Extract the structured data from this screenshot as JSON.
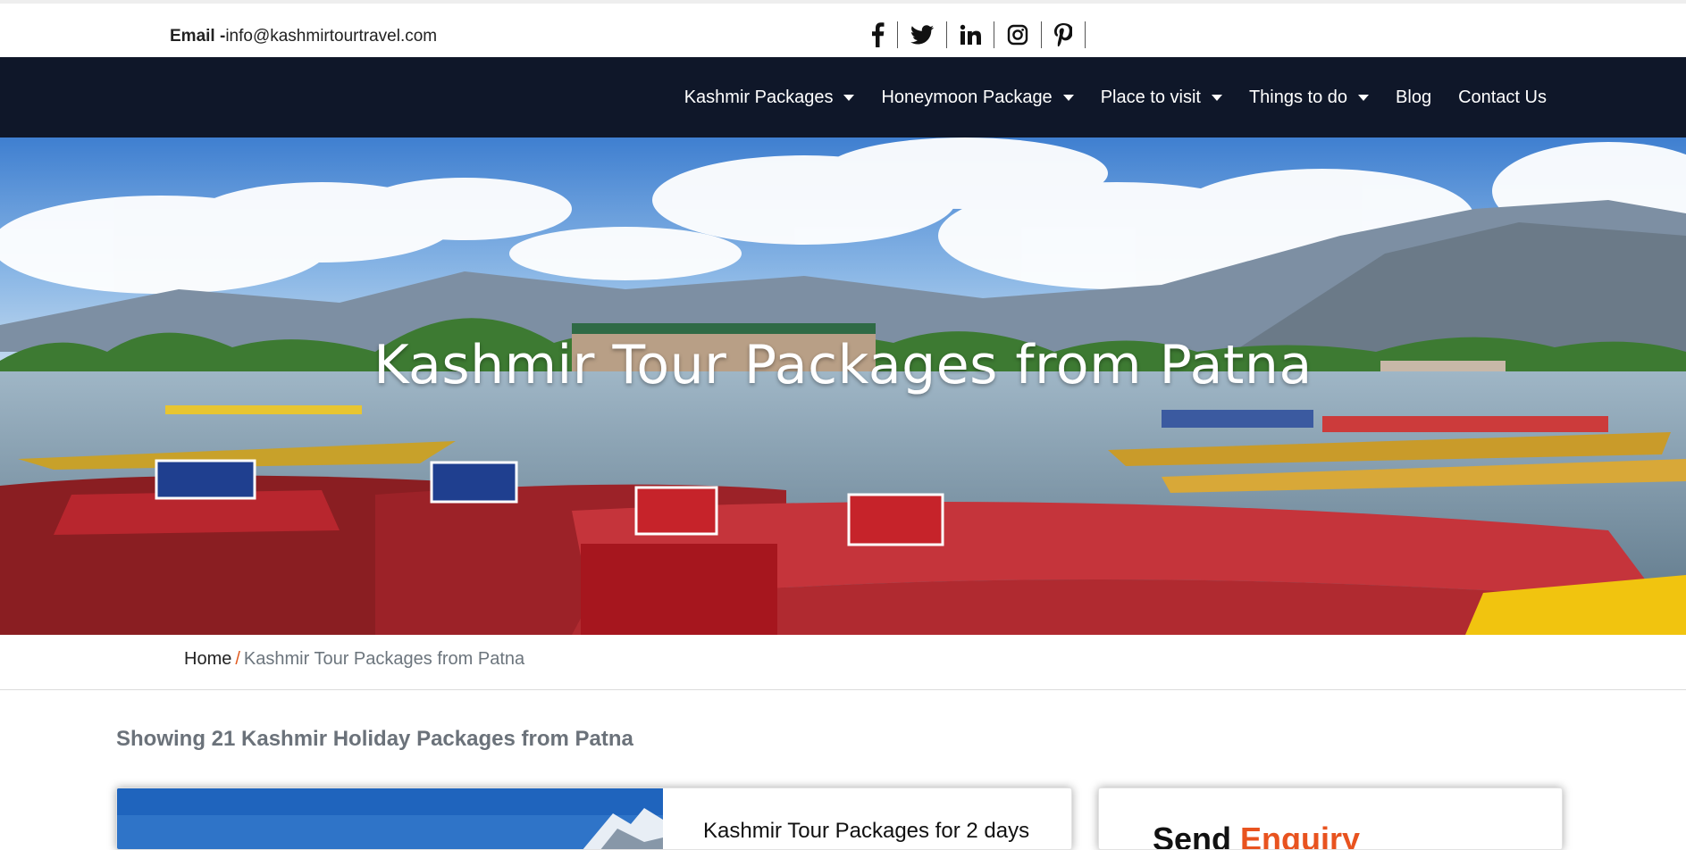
{
  "topbar": {
    "email_label": "Email -",
    "email_value": "info@kashmirtourtravel.com",
    "social": [
      "facebook-icon",
      "twitter-icon",
      "linkedin-icon",
      "instagram-icon",
      "pinterest-icon"
    ]
  },
  "nav": {
    "items": [
      {
        "label": "Kashmir Packages",
        "dropdown": true
      },
      {
        "label": "Honeymoon Package",
        "dropdown": true
      },
      {
        "label": "Place to visit",
        "dropdown": true
      },
      {
        "label": "Things to do",
        "dropdown": true
      },
      {
        "label": "Blog",
        "dropdown": false
      },
      {
        "label": "Contact Us",
        "dropdown": false
      }
    ]
  },
  "hero": {
    "title": "Kashmir Tour Packages from Patna"
  },
  "breadcrumb": {
    "home": "Home",
    "separator": "/",
    "current": "Kashmir Tour Packages from Patna"
  },
  "listing": {
    "showing_text": "Showing 21 Kashmir Holiday Packages from Patna"
  },
  "package_card": {
    "title": "Kashmir Tour Packages for 2 days"
  },
  "enquiry_card": {
    "title_part1": "Send ",
    "title_part2": "Enquiry"
  },
  "colors": {
    "navbar_bg": "#0f1729",
    "accent": "#e8531f",
    "muted_text": "#6b727a"
  }
}
